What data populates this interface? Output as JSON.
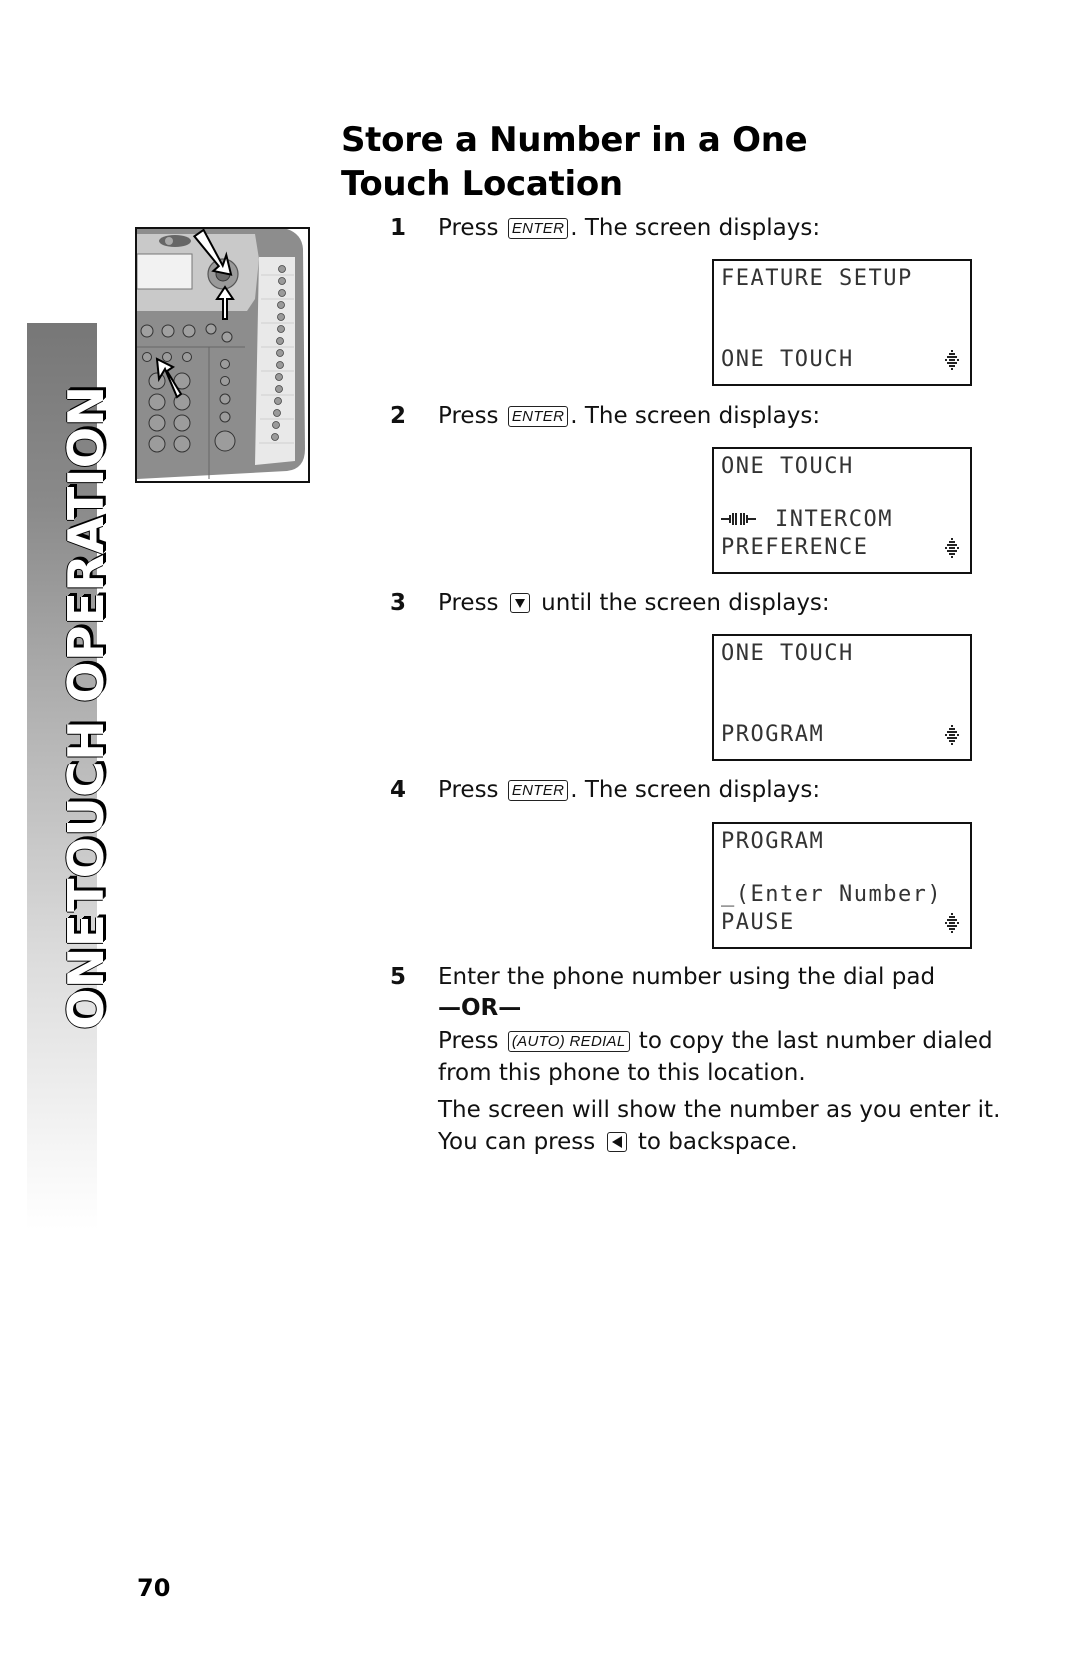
{
  "side_tab": {
    "label_word1": "ONE",
    "label_word2": "TOUCH OPERATION"
  },
  "title": {
    "line1": "Store a Number in a One",
    "line2": "Touch Location"
  },
  "keys": {
    "enter": "ENTER",
    "auto_redial": "(AUTO) REDIAL",
    "down_arrow": "down-arrow-key",
    "left_arrow": "left-arrow-key"
  },
  "steps": [
    {
      "number": "1",
      "pre": "Press",
      "post": ". The screen displays:",
      "screen": {
        "line1": "FEATURE SETUP",
        "line3": "",
        "line4": "ONE TOUCH"
      }
    },
    {
      "number": "2",
      "pre": "Press",
      "post": ". The screen displays:",
      "screen": {
        "line1": "ONE TOUCH",
        "line3": "INTERCOM",
        "line4": "PREFERENCE"
      }
    },
    {
      "number": "3",
      "pre": "Press",
      "post": " until the screen displays:",
      "screen": {
        "line1": "ONE TOUCH",
        "line3": "",
        "line4": "PROGRAM"
      }
    },
    {
      "number": "4",
      "pre": "Press",
      "post": ". The screen displays:",
      "screen": {
        "line1": "PROGRAM",
        "line3": "_(Enter Number)",
        "line4": "PAUSE"
      }
    },
    {
      "number": "5",
      "line1": "Enter the phone number using the dial pad",
      "or": "—OR—",
      "press": "Press",
      "copy_text": " to copy the last number dialed",
      "copy_text2": "from this phone to this location.",
      "info1": "The screen will show the number as you enter it.",
      "info2_pre": "You can press",
      "info2_post": " to backspace."
    }
  ],
  "page_number": "70"
}
